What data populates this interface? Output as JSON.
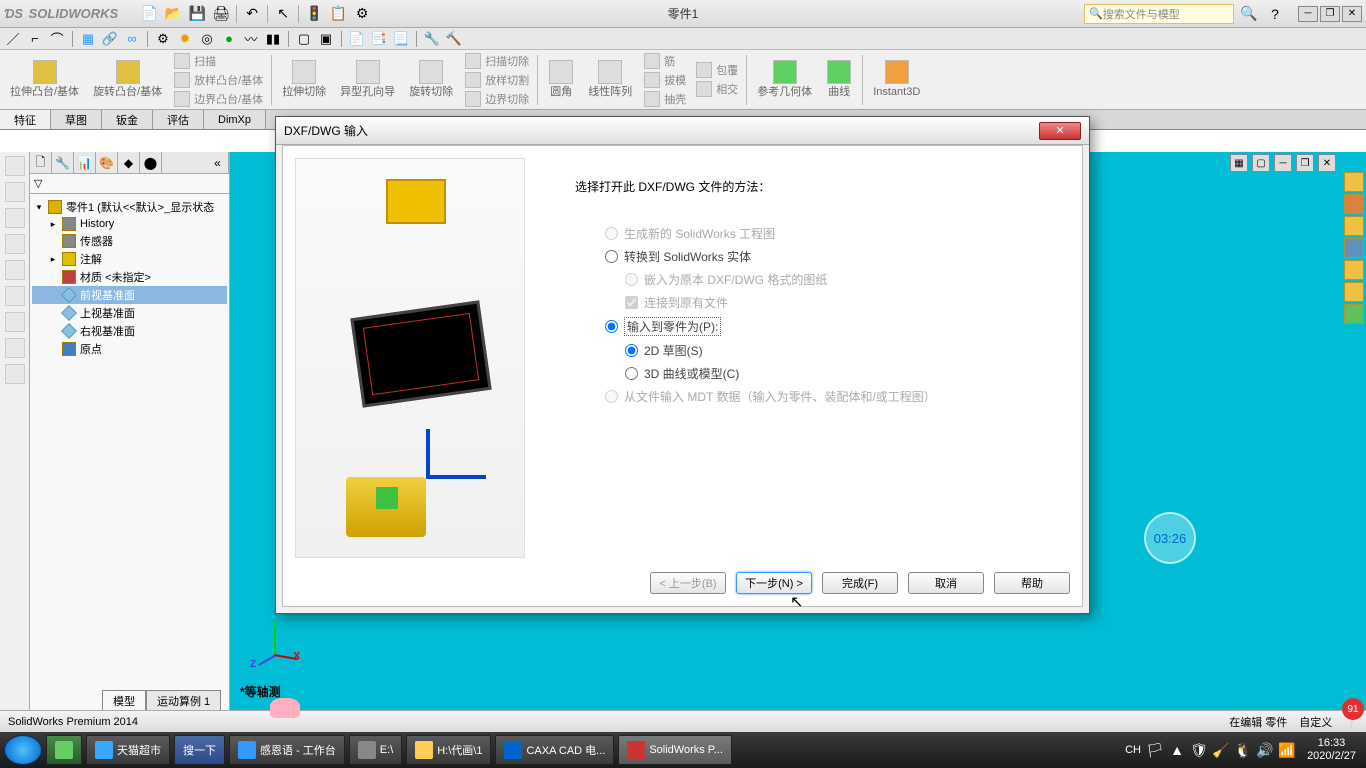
{
  "app": {
    "name": "SOLIDWORKS",
    "doc_title": "零件1",
    "search_placeholder": "搜索文件与模型"
  },
  "ribbon": {
    "btn1": "拉伸凸台/基体",
    "btn2": "旋转凸台/基体",
    "group1": [
      "扫描",
      "放样凸台/基体",
      "边界凸台/基体"
    ],
    "btn3": "拉伸切除",
    "btn4": "异型孔向导",
    "btn5": "旋转切除",
    "group2": [
      "扫描切除",
      "放样切割",
      "边界切除"
    ],
    "btn6": "圆角",
    "btn7": "线性阵列",
    "btn8": "筋",
    "btn9": "拔模",
    "btn10": "抽壳",
    "btn11": "包覆",
    "btn12": "相交",
    "btn13": "参考几何体",
    "btn14": "曲线",
    "btn15": "Instant3D"
  },
  "tabs": [
    "特征",
    "草图",
    "钣金",
    "评估",
    "DimXp"
  ],
  "tree": {
    "root": "零件1 (默认<<默认>_显示状态",
    "items": [
      "History",
      "传感器",
      "注解",
      "材质 <未指定>",
      "前视基准面",
      "上视基准面",
      "右视基准面",
      "原点"
    ]
  },
  "iso_label": "*等轴测",
  "bottom_tabs": [
    "模型",
    "运动算例 1"
  ],
  "status": {
    "left": "SolidWorks Premium 2014",
    "right1": "在编辑 零件",
    "right2": "自定义"
  },
  "dialog": {
    "title": "DXF/DWG 输入",
    "prompt": "选择打开此 DXF/DWG 文件的方法：",
    "opt1": "生成新的 SolidWorks 工程图",
    "opt2": "转换到 SolidWorks 实体",
    "opt2a": "嵌入为原本 DXF/DWG 格式的图纸",
    "opt2b": "连接到原有文件",
    "opt3": "输入到零件为(P):",
    "opt3a": "2D 草图(S)",
    "opt3b": "3D 曲线或模型(C)",
    "opt4": "从文件输入 MDT 数据（输入为零件、装配体和/或工程图）",
    "btn_back": "< 上一步(B)",
    "btn_next": "下一步(N) >",
    "btn_finish": "完成(F)",
    "btn_cancel": "取消",
    "btn_help": "帮助"
  },
  "timer": "03:26",
  "taskbar": {
    "search": "搜一下",
    "items": [
      "天猫超市",
      "感恩语 - 工作台",
      "E:\\",
      "H:\\代画\\1",
      "CAXA CAD 电...",
      "SolidWorks P..."
    ],
    "ime": "CH",
    "time": "16:33",
    "date": "2020/2/27"
  },
  "badge": "91"
}
